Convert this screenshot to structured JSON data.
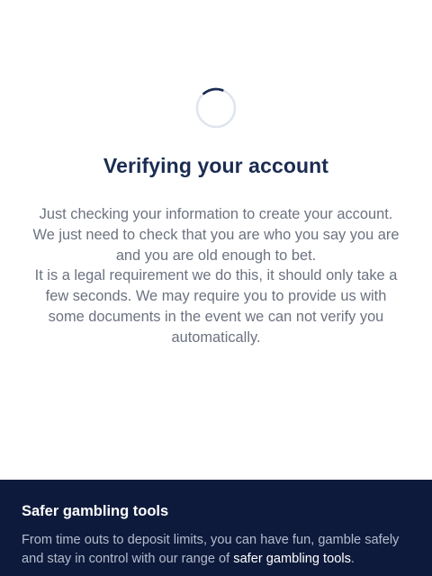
{
  "verification": {
    "title": "Verifying your account",
    "message_lines": [
      "Just checking your information to create your account.",
      "We just need to check that you are who you say you are",
      "and you are old enough to bet.",
      "It is a legal requirement we do this, it should only take a",
      "few seconds. We may require you to provide us with",
      "some documents in the event we can not verify you",
      "automatically."
    ]
  },
  "footer": {
    "title": "Safer gambling tools",
    "text_before_link": "From time outs to deposit limits, you can have fun, gamble safely and stay in control with our range of ",
    "link_label": "safer gambling tools",
    "text_after_link": "."
  },
  "colors": {
    "title": "#1b2c52",
    "body_text": "#6c7280",
    "footer_bg": "#0e1a3c",
    "spinner_track": "#dfe4ee",
    "spinner_arc": "#1b2c52"
  },
  "icons": {
    "spinner": "loading-spinner-icon"
  }
}
